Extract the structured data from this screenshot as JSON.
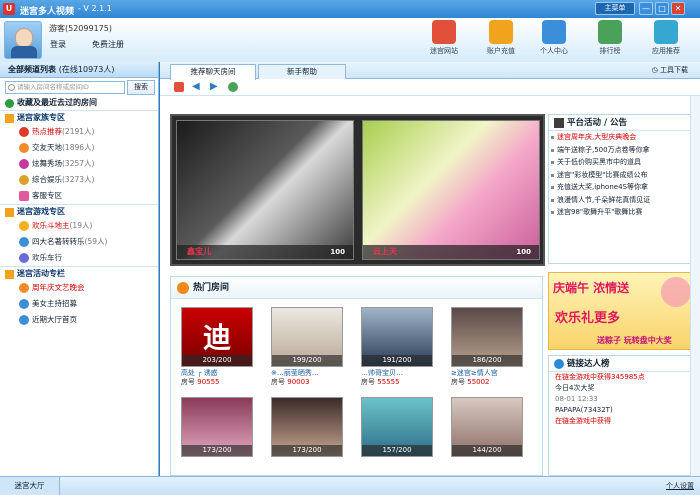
{
  "titlebar": {
    "title": "迷宫多人视频",
    "version": "- V 2.1.1",
    "main_menu": "主菜单",
    "min": "—",
    "max": "□",
    "close": "✕"
  },
  "user": {
    "name": "游客(52099175)",
    "login": "登录",
    "register": "免费注册"
  },
  "toolbar": [
    {
      "label": "迷宫网站",
      "color": "#e0503a"
    },
    {
      "label": "账户充值",
      "color": "#f2a31e"
    },
    {
      "label": "个人中心",
      "color": "#3b8fd8"
    },
    {
      "label": "排行榜",
      "color": "#4aa25a"
    },
    {
      "label": "应用推荐",
      "color": "#35a7d1"
    }
  ],
  "sidebar": {
    "title": "全部频道列表",
    "online": "(在线10973人)",
    "search_placeholder": "请输入房间名称或房间ID",
    "search_button": "搜索",
    "favorites": "收藏及最近去过的房间",
    "categories": [
      {
        "name": "迷宫家族专区",
        "items": [
          {
            "label": "热点推荐",
            "count": "(2191人)",
            "red": true
          },
          {
            "label": "交友天地",
            "count": "(1896人)",
            "red": false
          },
          {
            "label": "炫舞秀场",
            "count": "(3257人)",
            "red": false
          },
          {
            "label": "综合娱乐",
            "count": "(3273人)",
            "red": false
          },
          {
            "label": "客服专区",
            "count": "",
            "red": false
          }
        ]
      },
      {
        "name": "迷宫游戏专区",
        "items": [
          {
            "label": "欢乐斗地主",
            "count": "(19人)",
            "red": true
          },
          {
            "label": "四大名著转转乐",
            "count": "(59人)",
            "red": false
          },
          {
            "label": "欢乐车行",
            "count": "",
            "red": false
          }
        ]
      },
      {
        "name": "迷宫活动专栏",
        "items": [
          {
            "label": "周年庆文艺晚会",
            "count": "",
            "red": true
          },
          {
            "label": "美女主持招募",
            "count": "",
            "red": false
          },
          {
            "label": "近期大厅首页",
            "count": "",
            "red": false
          }
        ]
      }
    ]
  },
  "tabs": {
    "active": "推荐聊天房间",
    "other": "新手帮助",
    "tools": "工具下载"
  },
  "featured": [
    {
      "name": "鑫宝儿",
      "count": "100"
    },
    {
      "name": "云上天",
      "count": "100"
    }
  ],
  "announcements": {
    "title": "平台活动 / 公告",
    "items": [
      {
        "text": "迷宫周年庆,大型庆典晚会",
        "red": true
      },
      {
        "text": "端午送粽子,500万点卷等你拿",
        "red": false
      },
      {
        "text": "关于低价购买黑市中的道具",
        "red": false
      },
      {
        "text": "迷宫\"彩妆模型\"比赛成绩公布",
        "red": false
      },
      {
        "text": "充值送大奖,iphone4S等你拿",
        "red": false
      },
      {
        "text": "浪漫情人节,千朵鲜花真情见证",
        "red": false
      },
      {
        "text": "迷宫98\"歌舞升平\"歌舞比赛",
        "red": false
      }
    ]
  },
  "hot": {
    "title": "热门房间",
    "rooms": [
      {
        "count": "203/200",
        "name": "高处 ┌ 诱惑",
        "id": "90555",
        "bg": "linear-gradient(#c80000,#7a0000)",
        "glyph": "迪"
      },
      {
        "count": "199/200",
        "name": "※…丽莹晒秀…",
        "id": "90003",
        "bg": "linear-gradient(#ece8e0,#b8a898)",
        "glyph": ""
      },
      {
        "count": "191/200",
        "name": "…帅哥宝贝…",
        "id": "55555",
        "bg": "linear-gradient(#9fb3c9,#2b3d56)",
        "glyph": ""
      },
      {
        "count": "186/200",
        "name": "≥迷宫≥情人宫",
        "id": "55002",
        "bg": "linear-gradient(#5b4a4a,#b8a08e)",
        "glyph": ""
      },
      {
        "count": "173/200",
        "name": "",
        "id": "",
        "bg": "linear-gradient(#8a3b5a,#e2a8c0)",
        "glyph": ""
      },
      {
        "count": "173/200",
        "name": "",
        "id": "",
        "bg": "linear-gradient(#3c2a2a,#c8a890)",
        "glyph": ""
      },
      {
        "count": "157/200",
        "name": "",
        "id": "",
        "bg": "linear-gradient(#6cc2c8,#2e6e8a)",
        "glyph": ""
      },
      {
        "count": "144/200",
        "name": "",
        "id": "",
        "bg": "linear-gradient(#d7c9c0,#8e6f68)",
        "glyph": ""
      }
    ],
    "room_prefix": "房号"
  },
  "promo": {
    "line1": "庆端午 浓情送",
    "line2": "欢乐礼更多",
    "line3": "送粽子 玩转盘中大奖"
  },
  "winners": {
    "title": "链接达人榜",
    "lines": [
      {
        "text": "在链金游戏中获得345985点",
        "cls": "red"
      },
      {
        "text": "今日4次大奖",
        "cls": ""
      },
      {
        "text": "   08-01 12:33",
        "cls": "gray"
      },
      {
        "text": "PAPAPA(73432T)",
        "cls": ""
      },
      {
        "text": "在链金游戏中获得",
        "cls": "red"
      }
    ]
  },
  "footer": {
    "hall": "迷宫大厅",
    "settings": "个人设置"
  }
}
